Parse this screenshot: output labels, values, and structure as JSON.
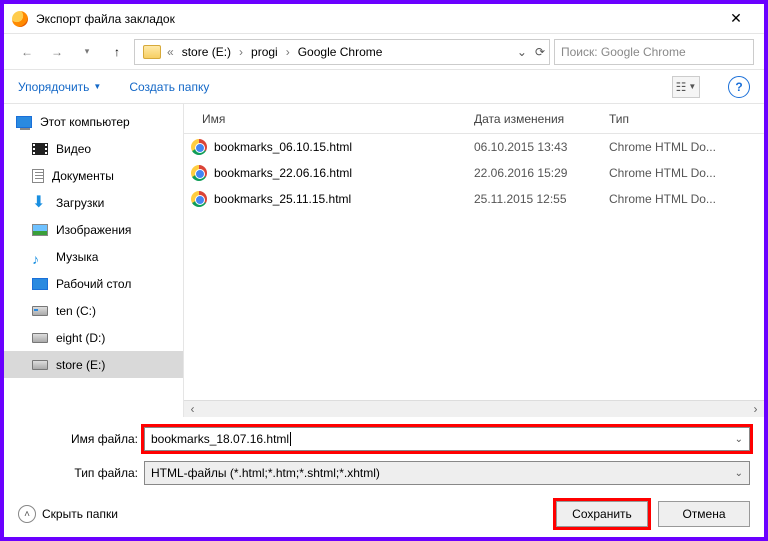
{
  "window": {
    "title": "Экспорт файла закладок"
  },
  "breadcrumb": {
    "segments": [
      "store (E:)",
      "progi",
      "Google Chrome"
    ],
    "search_placeholder": "Поиск: Google Chrome"
  },
  "toolbar": {
    "organize": "Упорядочить",
    "newfolder": "Создать папку"
  },
  "columns": {
    "name": "Имя",
    "date": "Дата изменения",
    "type": "Тип"
  },
  "sidebar": {
    "root": "Этот компьютер",
    "items": [
      {
        "label": "Видео"
      },
      {
        "label": "Документы"
      },
      {
        "label": "Загрузки"
      },
      {
        "label": "Изображения"
      },
      {
        "label": "Музыка"
      },
      {
        "label": "Рабочий стол"
      },
      {
        "label": "ten (C:)"
      },
      {
        "label": "eight (D:)"
      },
      {
        "label": "store (E:)"
      }
    ]
  },
  "files": [
    {
      "name": "bookmarks_06.10.15.html",
      "date": "06.10.2015 13:43",
      "type": "Chrome HTML Do..."
    },
    {
      "name": "bookmarks_22.06.16.html",
      "date": "22.06.2016 15:29",
      "type": "Chrome HTML Do..."
    },
    {
      "name": "bookmarks_25.11.15.html",
      "date": "25.11.2015 12:55",
      "type": "Chrome HTML Do..."
    }
  ],
  "form": {
    "filename_label": "Имя файла:",
    "filename_value": "bookmarks_18.07.16.html",
    "filetype_label": "Тип файла:",
    "filetype_value": "HTML-файлы (*.html;*.htm;*.shtml;*.xhtml)"
  },
  "footer": {
    "hide_folders": "Скрыть папки",
    "save": "Сохранить",
    "cancel": "Отмена"
  }
}
